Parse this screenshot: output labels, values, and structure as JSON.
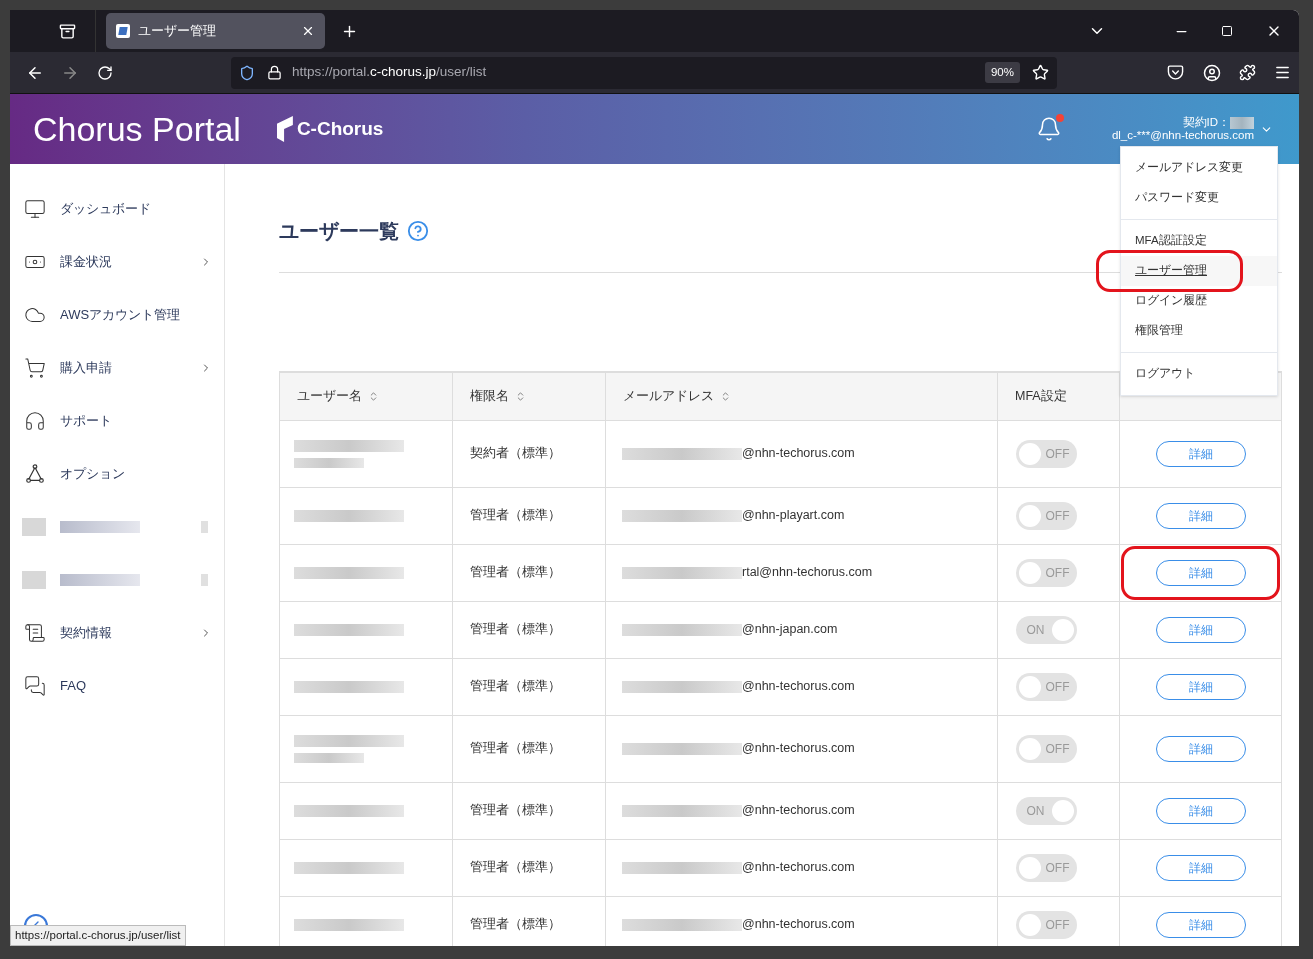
{
  "browser": {
    "tab": {
      "title": "ユーザー管理",
      "selected": true
    },
    "url": {
      "prefix": "https://portal.",
      "domain": "c-chorus.jp",
      "path": "/user/list"
    },
    "zoom": "90%"
  },
  "header": {
    "title": "Chorus Portal",
    "logo_text": "C-Chorus",
    "notification": true,
    "contract_label": "契約ID：",
    "account": "dl_c-***@nhn-techorus.com"
  },
  "sidebar": {
    "items": [
      {
        "kind": "link",
        "label": "ダッシュボード",
        "has_submenu": false
      },
      {
        "kind": "link",
        "label": "課金状況",
        "has_submenu": true
      },
      {
        "kind": "link",
        "label": "AWSアカウント管理",
        "has_submenu": false
      },
      {
        "kind": "link",
        "label": "購入申請",
        "has_submenu": true
      },
      {
        "kind": "link",
        "label": "サポート",
        "has_submenu": false
      },
      {
        "kind": "link",
        "label": "オプション",
        "has_submenu": false
      },
      {
        "kind": "redacted"
      },
      {
        "kind": "redacted"
      },
      {
        "kind": "link",
        "label": "契約情報",
        "has_submenu": true
      },
      {
        "kind": "link",
        "label": "FAQ",
        "has_submenu": false
      }
    ]
  },
  "page": {
    "title": "ユーザー一覧"
  },
  "account_menu": {
    "groups": [
      [
        {
          "label": "メールアドレス変更",
          "selected": false,
          "highlighted": false
        },
        {
          "label": "パスワード変更",
          "selected": false,
          "highlighted": false
        }
      ],
      [
        {
          "label": "MFA認証設定",
          "selected": false,
          "highlighted": false
        },
        {
          "label": "ユーザー管理",
          "selected": true,
          "highlighted": true
        },
        {
          "label": "ログイン履歴",
          "selected": false,
          "highlighted": false
        },
        {
          "label": "権限管理",
          "selected": false,
          "highlighted": false
        }
      ],
      [
        {
          "label": "ログアウト",
          "selected": false,
          "highlighted": false
        }
      ]
    ]
  },
  "table": {
    "columns": [
      {
        "kind": "sortable",
        "label": "ユーザー名"
      },
      {
        "kind": "sortable",
        "label": "権限名"
      },
      {
        "kind": "sortable",
        "label": "メールアドレス"
      },
      {
        "kind": "plain",
        "label": "MFA設定"
      },
      {
        "kind": "blank"
      }
    ],
    "rows": [
      {
        "name_wraps": true,
        "role": "契約者（標準）",
        "email": "@nhn-techorus.com",
        "mfa": {
          "on": false,
          "label": "OFF"
        },
        "action": "詳細",
        "highlighted": false
      },
      {
        "name_wraps": false,
        "role": "管理者（標準）",
        "email": "@nhn-playart.com",
        "mfa": {
          "on": false,
          "label": "OFF"
        },
        "action": "詳細",
        "highlighted": false
      },
      {
        "name_wraps": false,
        "role": "管理者（標準）",
        "email": "rtal@nhn-techorus.com",
        "mfa": {
          "on": false,
          "label": "OFF"
        },
        "action": "詳細",
        "highlighted": true
      },
      {
        "name_wraps": false,
        "role": "管理者（標準）",
        "email": "@nhn-japan.com",
        "mfa": {
          "on": true,
          "label": "ON"
        },
        "action": "詳細",
        "highlighted": false
      },
      {
        "name_wraps": false,
        "role": "管理者（標準）",
        "email": "@nhn-techorus.com",
        "mfa": {
          "on": false,
          "label": "OFF"
        },
        "action": "詳細",
        "highlighted": false
      },
      {
        "name_wraps": true,
        "role": "管理者（標準）",
        "email": "@nhn-techorus.com",
        "mfa": {
          "on": false,
          "label": "OFF"
        },
        "action": "詳細",
        "highlighted": false
      },
      {
        "name_wraps": false,
        "role": "管理者（標準）",
        "email": "@nhn-techorus.com",
        "mfa": {
          "on": true,
          "label": "ON"
        },
        "action": "詳細",
        "highlighted": false
      },
      {
        "name_wraps": false,
        "role": "管理者（標準）",
        "email": "@nhn-techorus.com",
        "mfa": {
          "on": false,
          "label": "OFF"
        },
        "action": "詳細",
        "highlighted": false
      },
      {
        "name_wraps": false,
        "role": "管理者（標準）",
        "email": "@nhn-techorus.com",
        "mfa": {
          "on": false,
          "label": "OFF"
        },
        "action": "詳細",
        "highlighted": false
      }
    ]
  },
  "status_url": "https://portal.c-chorus.jp/user/list"
}
